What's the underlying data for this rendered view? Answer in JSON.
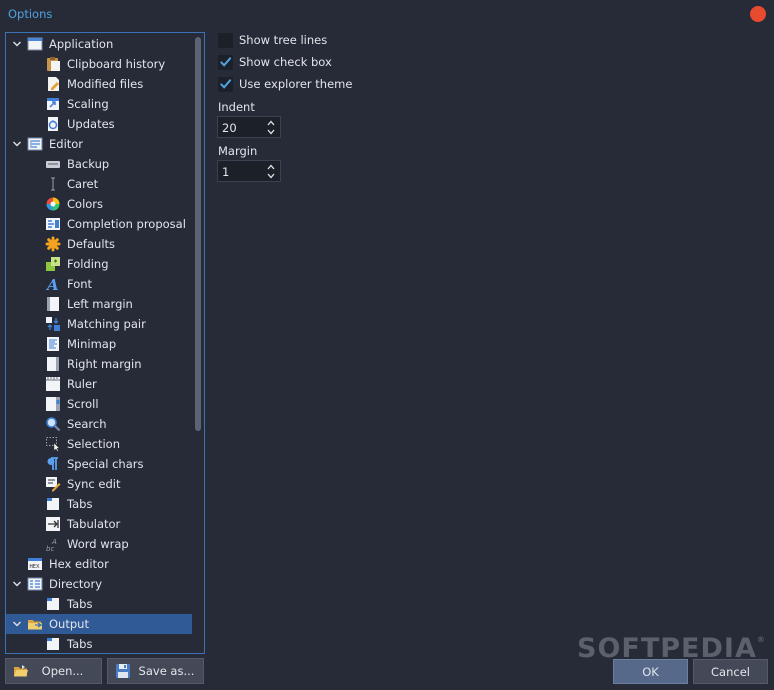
{
  "window": {
    "title": "Options"
  },
  "tree": {
    "nodes": [
      {
        "label": "Application",
        "icon": "window-icon",
        "level": 0,
        "expanded": true
      },
      {
        "label": "Clipboard history",
        "icon": "clipboard-icon",
        "level": 1
      },
      {
        "label": "Modified files",
        "icon": "edit-file-icon",
        "level": 1
      },
      {
        "label": "Scaling",
        "icon": "scaling-icon",
        "level": 1
      },
      {
        "label": "Updates",
        "icon": "update-icon",
        "level": 1
      },
      {
        "label": "Editor",
        "icon": "editor-icon",
        "level": 0,
        "expanded": true
      },
      {
        "label": "Backup",
        "icon": "backup-icon",
        "level": 1
      },
      {
        "label": "Caret",
        "icon": "caret-icon",
        "level": 1
      },
      {
        "label": "Colors",
        "icon": "colors-icon",
        "level": 1
      },
      {
        "label": "Completion proposal",
        "icon": "completion-icon",
        "level": 1
      },
      {
        "label": "Defaults",
        "icon": "defaults-icon",
        "level": 1
      },
      {
        "label": "Folding",
        "icon": "folding-icon",
        "level": 1
      },
      {
        "label": "Font",
        "icon": "font-icon",
        "level": 1
      },
      {
        "label": "Left margin",
        "icon": "left-margin-icon",
        "level": 1
      },
      {
        "label": "Matching pair",
        "icon": "matching-pair-icon",
        "level": 1
      },
      {
        "label": "Minimap",
        "icon": "minimap-icon",
        "level": 1
      },
      {
        "label": "Right margin",
        "icon": "right-margin-icon",
        "level": 1
      },
      {
        "label": "Ruler",
        "icon": "ruler-icon",
        "level": 1
      },
      {
        "label": "Scroll",
        "icon": "scroll-icon",
        "level": 1
      },
      {
        "label": "Search",
        "icon": "search-icon",
        "level": 1
      },
      {
        "label": "Selection",
        "icon": "selection-icon",
        "level": 1
      },
      {
        "label": "Special chars",
        "icon": "pilcrow-icon",
        "level": 1
      },
      {
        "label": "Sync edit",
        "icon": "sync-edit-icon",
        "level": 1
      },
      {
        "label": "Tabs",
        "icon": "tabs-icon",
        "level": 1
      },
      {
        "label": "Tabulator",
        "icon": "tabulator-icon",
        "level": 1
      },
      {
        "label": "Word wrap",
        "icon": "word-wrap-icon",
        "level": 1
      },
      {
        "label": "Hex editor",
        "icon": "hex-editor-icon",
        "level": 0
      },
      {
        "label": "Directory",
        "icon": "directory-icon",
        "level": 0,
        "expanded": true
      },
      {
        "label": "Tabs",
        "icon": "tabs-icon",
        "level": 1
      },
      {
        "label": "Output",
        "icon": "output-icon",
        "level": 0,
        "expanded": true,
        "selected": true
      },
      {
        "label": "Tabs",
        "icon": "tabs-icon",
        "level": 1
      }
    ]
  },
  "settings": {
    "show_tree_lines": {
      "label": "Show tree lines",
      "checked": false
    },
    "show_check_box": {
      "label": "Show check box",
      "checked": true
    },
    "use_explorer_theme": {
      "label": "Use explorer theme",
      "checked": true
    },
    "indent": {
      "label": "Indent",
      "value": "20"
    },
    "margin": {
      "label": "Margin",
      "value": "1"
    }
  },
  "buttons": {
    "open": "Open...",
    "save_as": "Save as...",
    "ok": "OK",
    "cancel": "Cancel"
  },
  "watermark": {
    "text": "SOFTPEDIA",
    "mark": "®"
  },
  "colors": {
    "background": "#262b37",
    "accent": "#4fa3e0",
    "selection": "#2f5a96",
    "close": "#e84a2f",
    "check": "#4fa3e0"
  }
}
